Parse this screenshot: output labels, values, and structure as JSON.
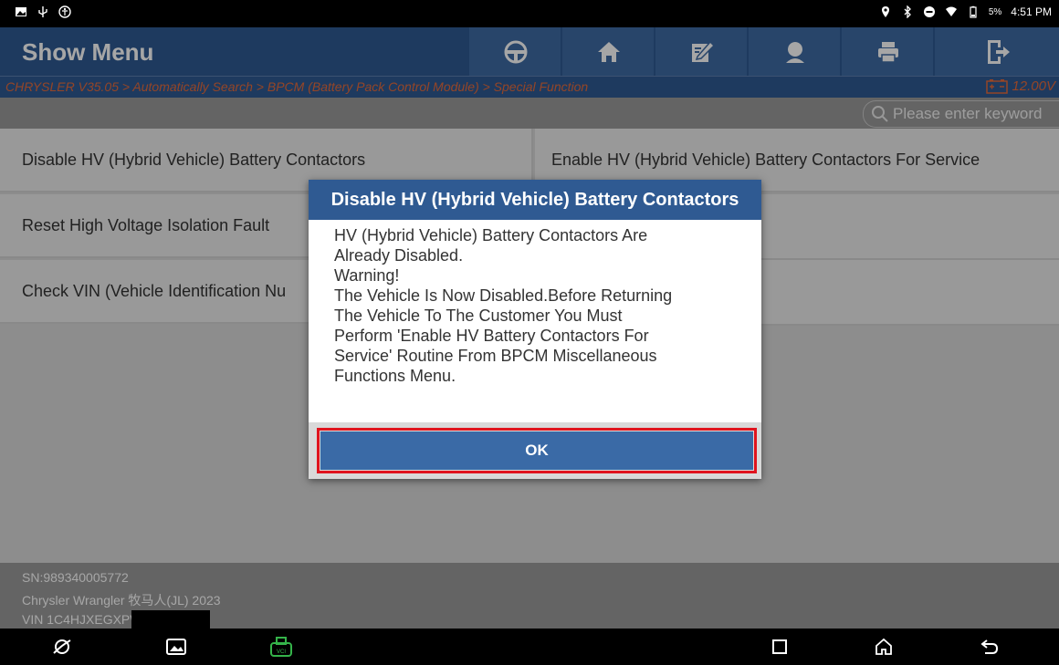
{
  "status_bar": {
    "battery_percent": "5%",
    "time": "4:51 PM"
  },
  "header": {
    "title": "Show Menu",
    "buttons": [
      "steering-wheel-icon",
      "home-icon",
      "edit-icon",
      "support-icon",
      "print-icon",
      "exit-icon"
    ]
  },
  "breadcrumb": "CHRYSLER V35.05 > Automatically Search > BPCM (Battery Pack Control Module) > Special Function",
  "voltage": "12.00V",
  "search": {
    "placeholder": "Please enter keyword"
  },
  "menu_items": [
    "Disable HV (Hybrid Vehicle) Battery Contactors",
    "Enable HV (Hybrid Vehicle) Battery Contactors For Service",
    "Reset High Voltage Isolation Fault",
    "Check VIN (Vehicle Identification Nu"
  ],
  "footer": {
    "sn": "SN:989340005772",
    "vehicle": "Chrysler Wrangler 牧马人(JL) 2023",
    "vin": "VIN 1C4HJXEGXPW5"
  },
  "dialog": {
    "title": "Disable HV (Hybrid Vehicle) Battery Contactors",
    "lines": [
      "HV (Hybrid Vehicle) Battery Contactors Are",
      "Already Disabled.",
      "Warning!",
      "The Vehicle Is Now Disabled.Before Returning",
      "The Vehicle To The Customer You Must",
      "Perform 'Enable HV Battery Contactors For",
      "Service' Routine From BPCM Miscellaneous",
      "Functions Menu."
    ],
    "ok_label": "OK"
  },
  "colors": {
    "header_blue": "#2f5a92",
    "breadcrumb_orange": "#e46b3c",
    "highlight_red": "#e0141e",
    "vci_green": "#35b44a"
  }
}
